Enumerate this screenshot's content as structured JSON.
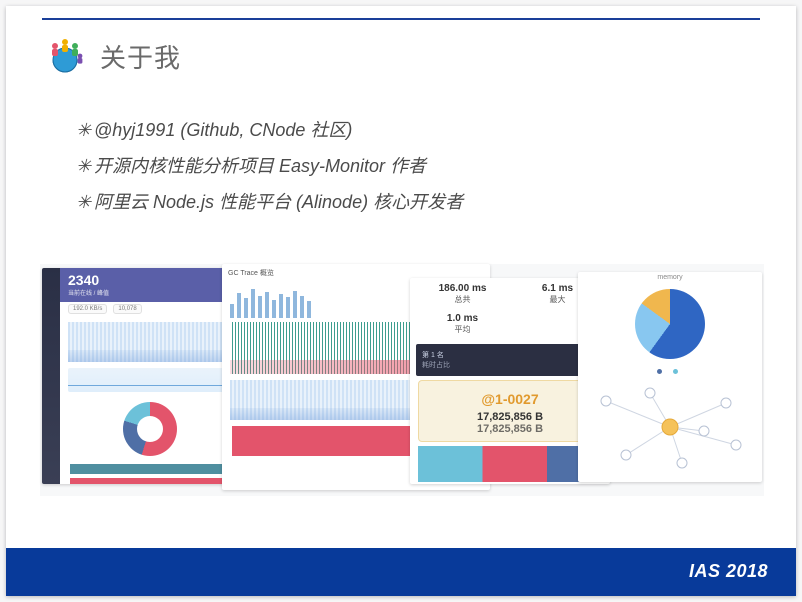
{
  "header": {
    "title": "关于我"
  },
  "bullets": [
    "@hyj1991 (Github, CNode 社区)",
    "开源内核性能分析项目 Easy-Monitor 作者",
    "阿里云 Node.js 性能平台 (Alinode) 核心开发者"
  ],
  "footer": {
    "label": "IAS 2018"
  },
  "gallery": {
    "panel1": {
      "bignum": "2340",
      "subline": "当前在线 / 峰值",
      "stat_row": [
        "192.0 KB/s",
        "10,078"
      ],
      "legend": [
        "pink",
        "blue",
        "teal"
      ]
    },
    "panel2": {
      "top_labels": [
        "GC Trace 概览"
      ],
      "kpis": [
        {
          "label": "总共",
          "value": "186.00 ms"
        },
        {
          "label": "最大",
          "value": "6.1 ms"
        },
        {
          "label": "平均",
          "value": "1.0 ms"
        }
      ]
    },
    "panel3": {
      "dark_card_title": "第 1 名",
      "dark_card_sub": "耗时占比",
      "orange_title": "@1-0027",
      "orange_l1": "17,825,856 B",
      "orange_l2": "17,825,856 B"
    },
    "panel4": {
      "top_text": "memory"
    }
  }
}
